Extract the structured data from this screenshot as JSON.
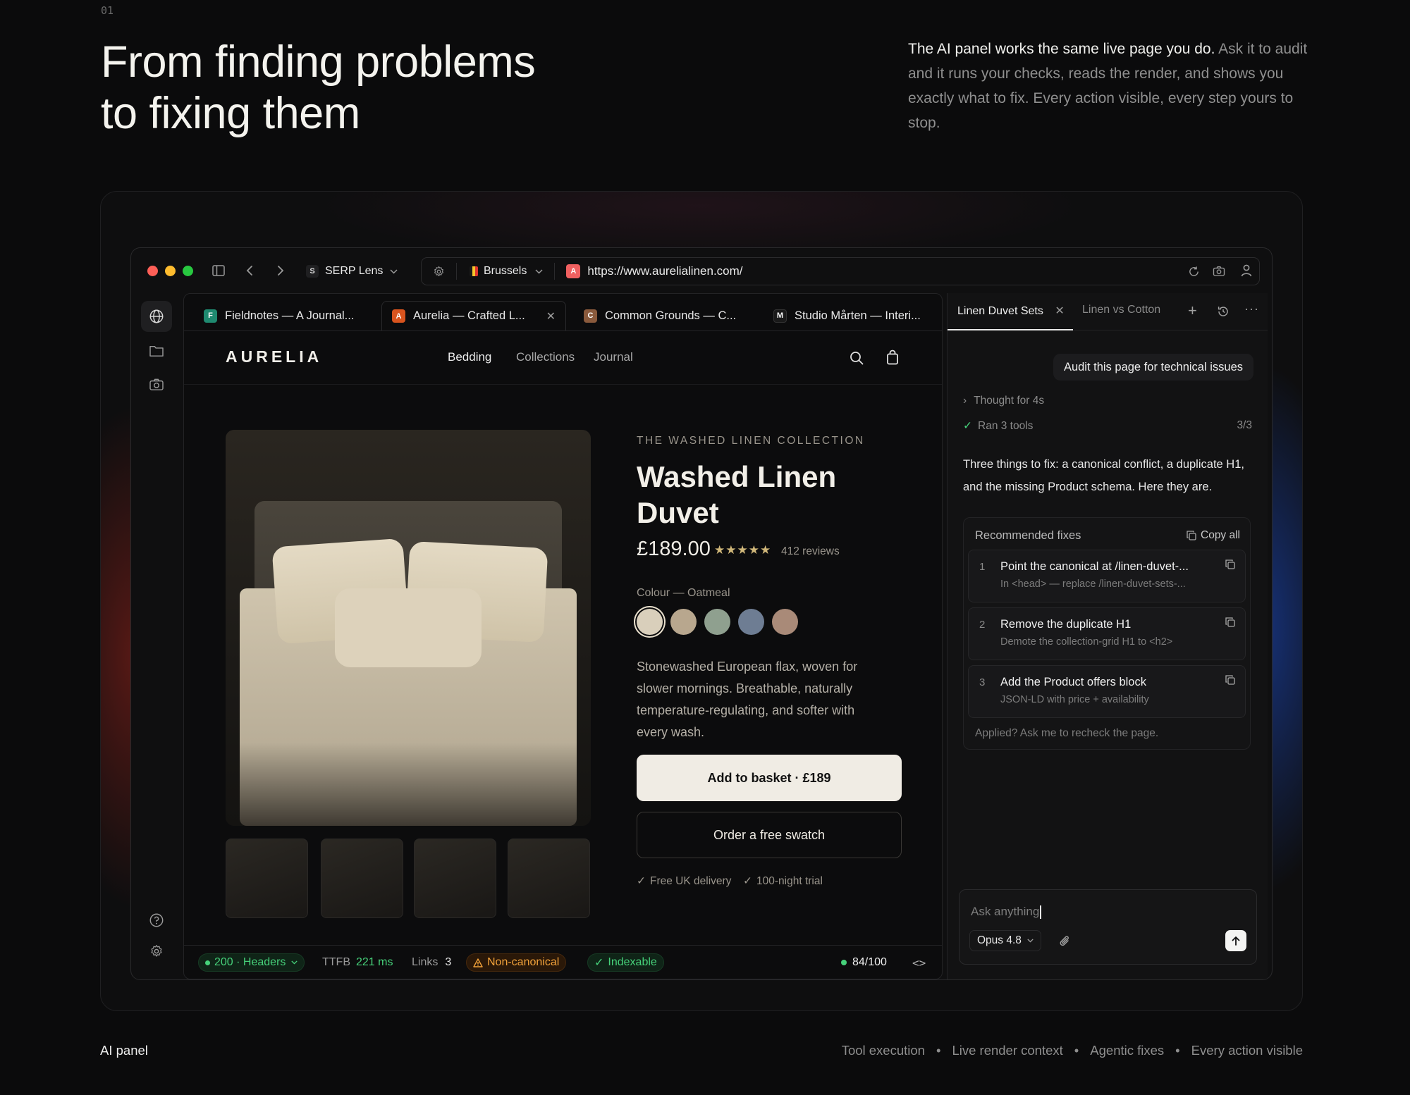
{
  "section": {
    "number": "01"
  },
  "hero": {
    "title_line1": "From finding problems",
    "title_line2": "to fixing them",
    "desc_lead": "The AI panel works the same live page you do.",
    "desc_body": "Ask it to audit and it runs your checks, reads the render, and shows you exactly what to fix. Every action visible, every step yours to stop."
  },
  "browser": {
    "profile": {
      "letter": "S",
      "label": "SERP Lens"
    },
    "location": {
      "label": "Brussels"
    },
    "url": {
      "favicon_letter": "A",
      "text": "https://www.aurelialinen.com/"
    },
    "tabs": [
      {
        "letter": "F",
        "label": "Fieldnotes — A Journal...",
        "color": "#1f8a70"
      },
      {
        "letter": "A",
        "label": "Aurelia — Crafted L...",
        "color": "#d9541e"
      },
      {
        "letter": "C",
        "label": "Common Grounds — C...",
        "color": "#8a5a3c"
      },
      {
        "letter": "M",
        "label": "Studio Mårten — Interi...",
        "color": "#1a1a1a"
      }
    ]
  },
  "site": {
    "logo": "AURELIA",
    "nav": [
      "Bedding",
      "Collections",
      "Journal"
    ],
    "product": {
      "eyebrow": "THE WASHED LINEN COLLECTION",
      "title": "Washed Linen Duvet",
      "price": "£189.00",
      "stars": "★★★★★",
      "rating": 5,
      "reviews": "412 reviews",
      "colour_label": "Colour — Oatmeal",
      "swatches": [
        "#d9cfbb",
        "#b8a78e",
        "#8fa08f",
        "#6e7d93",
        "#a98a78"
      ],
      "description": "Stonewashed European flax, woven for slower mornings. Breathable, naturally temperature-regulating, and softer with every wash.",
      "primary_cta": "Add to basket · £189",
      "secondary_cta": "Order a free swatch",
      "perks": [
        "Free UK delivery",
        "100-night trial"
      ]
    }
  },
  "status": {
    "http": "200 · Headers",
    "ttfb_label": "TTFB",
    "ttfb_value": "221 ms",
    "links_label": "Links",
    "links_value": "3",
    "canonical": "Non-canonical",
    "indexable": "Indexable",
    "score": "84/100"
  },
  "ai": {
    "tabs": [
      "Linen Duvet Sets",
      "Linen vs Cotton"
    ],
    "user_message": "Audit this page for technical issues",
    "thought": "Thought for 4s",
    "tools": "Ran 3 tools",
    "tools_count": "3/3",
    "answer": "Three things to fix: a canonical conflict, a duplicate H1, and the missing Product schema. Here they are.",
    "fixes_title": "Recommended fixes",
    "copy_all": "Copy all",
    "fixes": [
      {
        "num": "1",
        "title": "Point the canonical at /linen-duvet-...",
        "sub": "In <head> — replace /linen-duvet-sets-..."
      },
      {
        "num": "2",
        "title": "Remove the duplicate H1",
        "sub": "Demote the collection-grid H1 to <h2>"
      },
      {
        "num": "3",
        "title": "Add the Product offers block",
        "sub": "JSON-LD with price + availability"
      }
    ],
    "fixes_footer": "Applied? Ask me to recheck the page.",
    "composer_placeholder": "Ask anything",
    "model": "Opus 4.8"
  },
  "footer": {
    "left": "AI panel",
    "items": [
      "Tool execution",
      "Live render context",
      "Agentic fixes",
      "Every action visible"
    ],
    "separator": "•"
  },
  "colors": {
    "accent_green": "#3ecf6e",
    "warn_orange": "#f2a23a",
    "bg": "#0b0b0c"
  }
}
